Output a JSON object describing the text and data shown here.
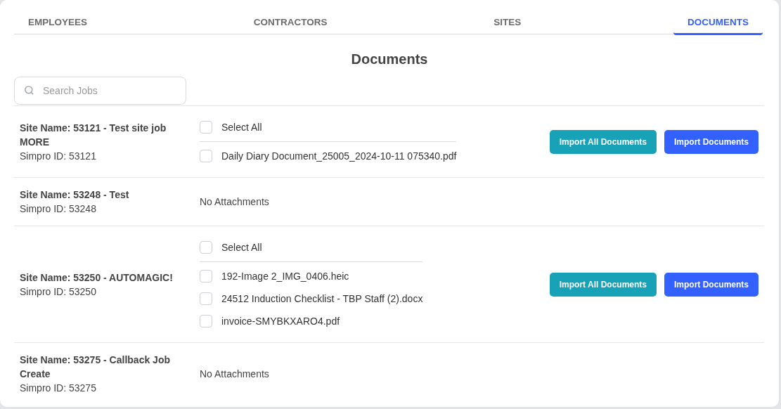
{
  "tabs": [
    {
      "label": "EMPLOYEES",
      "selected": false
    },
    {
      "label": "CONTRACTORS",
      "selected": false
    },
    {
      "label": "SITES",
      "selected": false
    },
    {
      "label": "DOCUMENTS",
      "selected": true
    }
  ],
  "heading": "Documents",
  "search": {
    "placeholder": "Search Jobs"
  },
  "sites": [
    {
      "site_name": "Site Name: 53121 - Test site job MORE",
      "simpro_id": "Simpro ID: 53121",
      "kind": "attachments",
      "select_all": {
        "label": "Select All",
        "checked": false
      },
      "files": [
        {
          "name": "Daily Diary Document_25005_2024-10-11 075340.pdf",
          "checked": false
        }
      ],
      "buttons": [
        {
          "label": "Import All Documents",
          "kind": "all"
        },
        {
          "label": "Import Documents",
          "kind": "selected"
        }
      ]
    },
    {
      "site_name": "Site Name: 53248 - Test",
      "simpro_id": "Simpro ID: 53248",
      "kind": "empty",
      "message": "No Attachments"
    },
    {
      "site_name": "Site Name: 53250 - AUTOMAGIC!",
      "simpro_id": "Simpro ID: 53250",
      "kind": "attachments",
      "select_all": {
        "label": "Select All",
        "checked": false
      },
      "files": [
        {
          "name": "192-Image 2_IMG_0406.heic",
          "checked": false
        },
        {
          "name": "24512 Induction Checklist - TBP Staff (2).docx",
          "checked": false
        },
        {
          "name": "invoice-SMYBKXARO4.pdf",
          "checked": false
        }
      ],
      "buttons": [
        {
          "label": "Import All Documents",
          "kind": "all"
        },
        {
          "label": "Import Documents",
          "kind": "selected"
        }
      ]
    },
    {
      "site_name": "Site Name: 53275 - Callback Job Create",
      "simpro_id": "Simpro ID: 53275",
      "kind": "empty",
      "message": "No Attachments"
    }
  ]
}
